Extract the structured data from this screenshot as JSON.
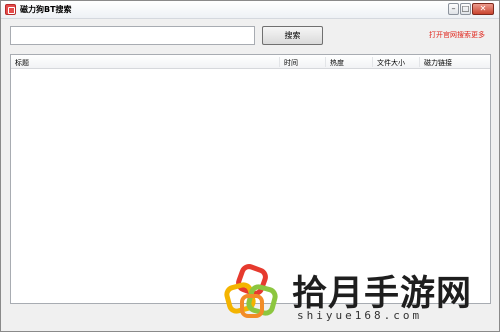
{
  "window": {
    "title": "磁力狗BT搜索",
    "minimize": "–",
    "maximize": "□",
    "close": "✕"
  },
  "search": {
    "value": "",
    "placeholder": "",
    "button_label": "搜索",
    "link_label": "打开官网搜索更多"
  },
  "table": {
    "columns": [
      "标题",
      "时间",
      "热度",
      "文件大小",
      "磁力链接"
    ],
    "rows": []
  },
  "watermark": {
    "text": "拾月手游网",
    "url": "shiyue168.com"
  },
  "colors": {
    "link": "#e0251b",
    "close": "#c9442f"
  }
}
